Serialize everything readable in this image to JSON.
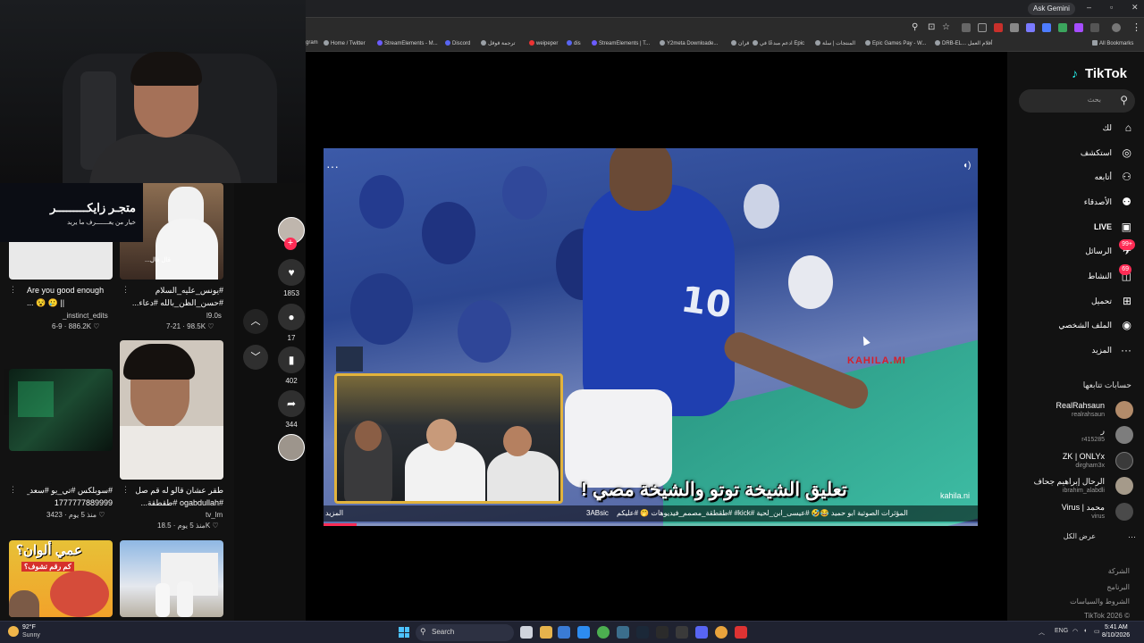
{
  "browser": {
    "ask_gemini": "Ask Gemini",
    "bookmarks": [
      "gram",
      "Home / Twitter",
      "StreamElements - M...",
      "Discord",
      "ترجمة قوقل",
      "weipeper",
      "dis",
      "StreamElements | T...",
      "Y2meta Downloade...",
      "قران",
      "ادعم مبدعًا في Epic",
      "المنتجات | سلة",
      "Epic Games Pay - W...",
      "DRB-EL... أقلام العمل",
      "All Bookmarks"
    ]
  },
  "overlay": {
    "banner_title": "متجـر زايكـــــــــر",
    "banner_subtitle": "خيار من يعـــــــرف ما يريد"
  },
  "feed": [
    {
      "title": "Are you good enough",
      "title2": "... 😵 🥲 ||",
      "user": "_instinct_edits",
      "views": "886.2K",
      "date": "6-9"
    },
    {
      "title": "#يونس_عليه_السلام",
      "title2": "#حسن_الظن_بالله #دعاء...",
      "user": "l9.0s",
      "views": "98.5K",
      "date": "7-21",
      "thumb_text": "قال قال..."
    },
    {
      "title": "#سوبلكس #تي_يو #سعد_فايز",
      "title2": "1777777889999",
      "user": "",
      "views": "3423",
      "date": "منذ 5 يوم"
    },
    {
      "title": "طقر عشان قالو له قم صل",
      "title2": "#ogabdullah #طقطقة...",
      "user": "tv_lm",
      "views": "18.5K",
      "date": "منذ 5 يوم"
    },
    {
      "title": "",
      "title2": "",
      "user": "",
      "views": "",
      "date": "",
      "thumb_text": "عمي ألوان؟",
      "thumb_sub": "كم رقم تشوف؟"
    },
    {
      "title": "",
      "title2": "",
      "user": "",
      "views": "",
      "date": ""
    }
  ],
  "video": {
    "caption": "تعليق الشيخة توتو والشيخة مصي !",
    "watermark": "KAHILA.MI",
    "handle": "kahila.ni",
    "strip_left": "المزيد",
    "strip_desc": "المؤثرات الصوتية ابو حميد 😂🤣 #عيسى_ابن_لحية #kick# #طقطقة_مصمم_فيديوهات 🤭 #عليكم",
    "strip_time": "3ABsic",
    "progress": 0.05
  },
  "actions": {
    "likes": "1853",
    "comments": "17",
    "saves": "402",
    "shares": "344"
  },
  "sidebar": {
    "logo": "TikTok",
    "search_placeholder": "بحث",
    "nav": [
      {
        "label": "لك",
        "icon": "home-icon"
      },
      {
        "label": "استكشف",
        "icon": "compass-icon"
      },
      {
        "label": "أتابعه",
        "icon": "following-icon"
      },
      {
        "label": "الأصدقاء",
        "icon": "friends-icon"
      },
      {
        "label": "LIVE",
        "icon": "live-icon"
      },
      {
        "label": "الرسائل",
        "icon": "messages-icon",
        "badge": "99+"
      },
      {
        "label": "النشاط",
        "icon": "activity-icon",
        "badge": "69"
      },
      {
        "label": "تحميل",
        "icon": "upload-icon"
      },
      {
        "label": "الملف الشخصي",
        "icon": "profile-icon"
      },
      {
        "label": "المزيد",
        "icon": "more-icon"
      }
    ],
    "following_title": "حسابات تتابعها",
    "accounts": [
      {
        "name": "RealRahsaun",
        "handle": "realrahsaun",
        "color": "#b28b6a"
      },
      {
        "name": "ر",
        "handle": "r415285",
        "color": "#7d7d7d"
      },
      {
        "name": "ZK | ONLYx",
        "handle": "dirgham3x",
        "color": "#3a3a3a"
      },
      {
        "name": "الرحال إبراهيم جحاف",
        "handle": "ibrahim_alabdli",
        "color": "#a59a8a"
      },
      {
        "name": "Virus | محمد",
        "handle": "virus",
        "color": "#4a4a4a"
      }
    ],
    "see_all": "عرض الكل",
    "footer": [
      "الشركة",
      "البرنامج",
      "الشروط والسياسات",
      "TikTok 2026 ©"
    ]
  },
  "taskbar": {
    "weather_temp": "92°F",
    "weather_desc": "Sunny",
    "search_label": "Search",
    "lang": "ENG",
    "time": "5:41 AM",
    "date": "8/10/2026"
  }
}
